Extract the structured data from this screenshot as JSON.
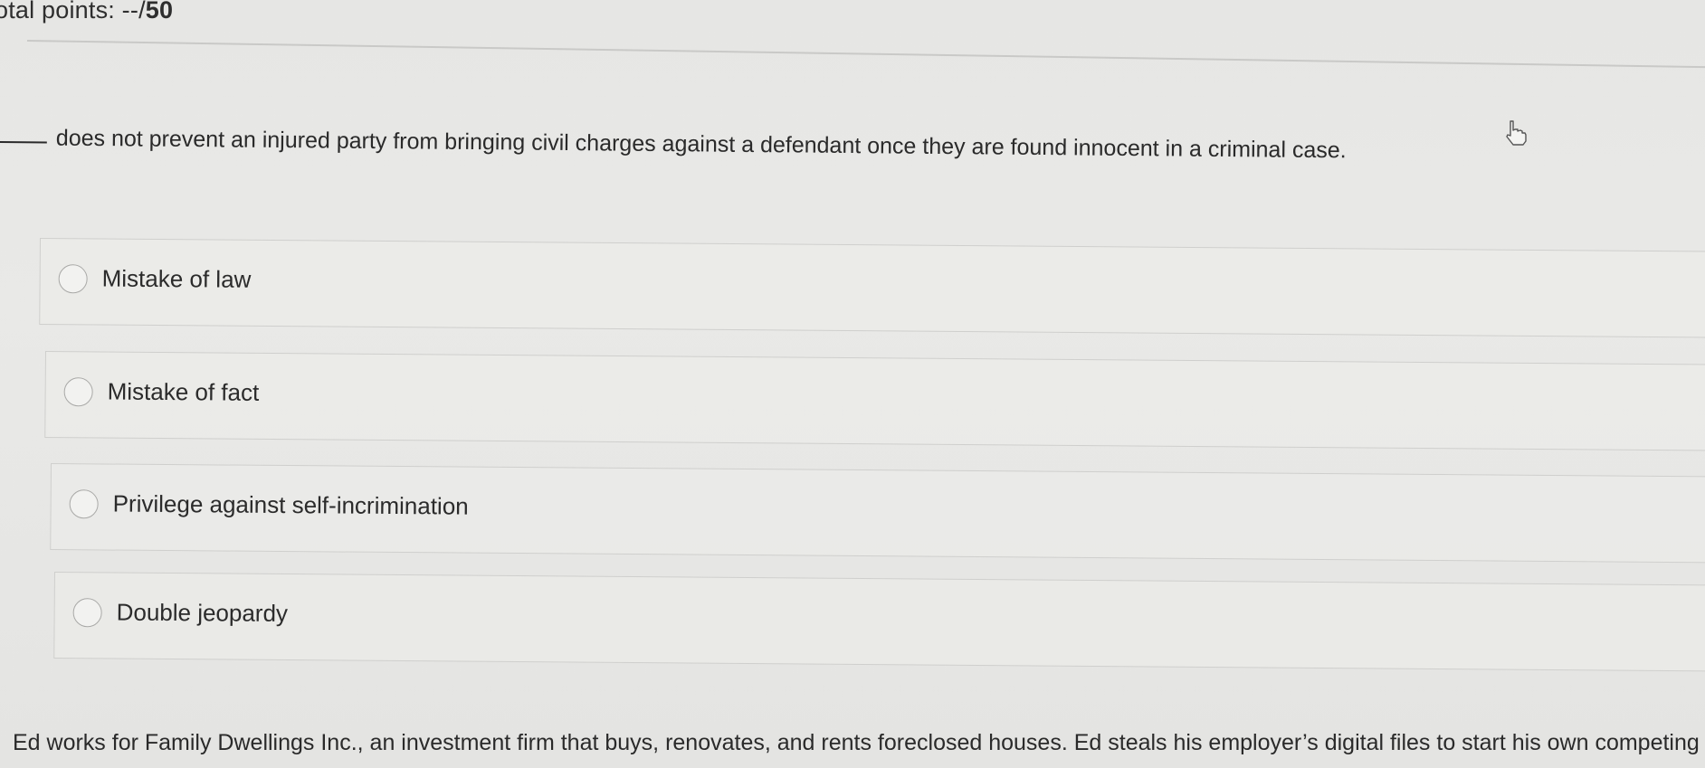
{
  "header": {
    "total_points_prefix": "otal points: --/",
    "total_points_score": "50"
  },
  "question": {
    "blank": "_____",
    "text": "does not prevent an injured party from bringing civil charges against a defendant once they are found innocent in a criminal case."
  },
  "options": [
    {
      "label": "Mistake of law"
    },
    {
      "label": "Mistake of fact"
    },
    {
      "label": "Privilege against self-incrimination"
    },
    {
      "label": "Double jeopardy"
    }
  ],
  "next_question": {
    "text": "Ed works for Family Dwellings Inc., an investment firm that buys, renovates, and rents foreclosed houses. Ed steals his employer’s digital files to start his own competing b"
  },
  "icons": {
    "cursor": "hand-pointer-cursor-icon",
    "radio": "radio-unchecked-icon"
  }
}
